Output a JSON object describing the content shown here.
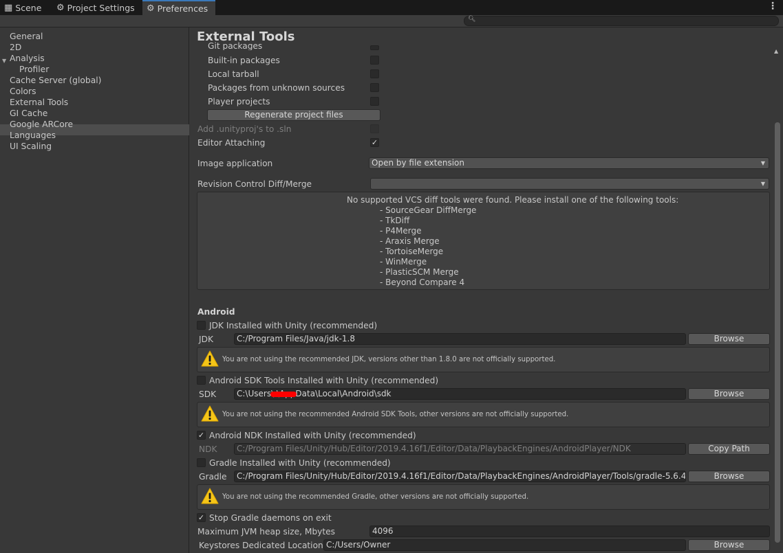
{
  "tabs": [
    {
      "label": "Scene",
      "icon": "scene-icon"
    },
    {
      "label": "Project Settings",
      "icon": "gear-icon"
    },
    {
      "label": "Preferences",
      "icon": "gear-icon"
    }
  ],
  "search": {
    "placeholder": ""
  },
  "sidebar": {
    "items": [
      "General",
      "2D",
      "Analysis",
      "Profiler",
      "Cache Server (global)",
      "Colors",
      "External Tools",
      "GI Cache",
      "Google ARCore",
      "Languages",
      "UI Scaling"
    ],
    "selected": "External Tools"
  },
  "page": {
    "title": "External Tools",
    "packages": {
      "git": "Git packages",
      "builtin": "Built-in packages",
      "tarball": "Local tarball",
      "unknown": "Packages from unknown sources",
      "player": "Player projects",
      "regen_button": "Regenerate project files",
      "add_unityproj": "Add .unityproj's to .sln",
      "editor_attaching": "Editor Attaching"
    },
    "image_app": {
      "label": "Image application",
      "value": "Open by file extension"
    },
    "revision": {
      "label": "Revision Control Diff/Merge",
      "value": ""
    },
    "vcs_message": {
      "header": "No supported VCS diff tools were found. Please install one of the following tools:",
      "tools": [
        "- SourceGear DiffMerge",
        "- TkDiff",
        "- P4Merge",
        "- Araxis Merge",
        "- TortoiseMerge",
        "- WinMerge",
        "- PlasticSCM Merge",
        "- Beyond Compare 4"
      ]
    },
    "android": {
      "section": "Android",
      "jdk_check": "JDK Installed with Unity (recommended)",
      "jdk_label": "JDK",
      "jdk_path": "C:/Program Files/Java/jdk-1.8",
      "jdk_warning": "You are not using the recommended JDK, versions other than 1.8.0 are not officially supported.",
      "sdk_check": "Android SDK Tools Installed with Unity (recommended)",
      "sdk_label": "SDK",
      "sdk_path": "C:\\Users\\      \\AppData\\Local\\Android\\sdk",
      "sdk_warning": "You are not using the recommended Android SDK Tools, other versions are not officially supported.",
      "ndk_check": "Android NDK Installed with Unity (recommended)",
      "ndk_label": "NDK",
      "ndk_path": "C:/Program Files/Unity/Hub/Editor/2019.4.16f1/Editor/Data/PlaybackEngines/AndroidPlayer/NDK",
      "copy_path": "Copy Path",
      "gradle_check": "Gradle Installed with Unity (recommended)",
      "gradle_label": "Gradle",
      "gradle_path": "C:/Program Files/Unity/Hub/Editor/2019.4.16f1/Editor/Data/PlaybackEngines/AndroidPlayer/Tools/gradle-5.6.4",
      "gradle_warning": "You are not using the recommended Gradle, other versions are not officially supported.",
      "stop_gradle": "Stop Gradle daemons on exit",
      "jvm_label": "Maximum JVM heap size, Mbytes",
      "jvm_value": "4096",
      "keystore_label": "Keystores Dedicated Location",
      "keystore_value": "C:/Users/Owner",
      "browse": "Browse"
    }
  }
}
